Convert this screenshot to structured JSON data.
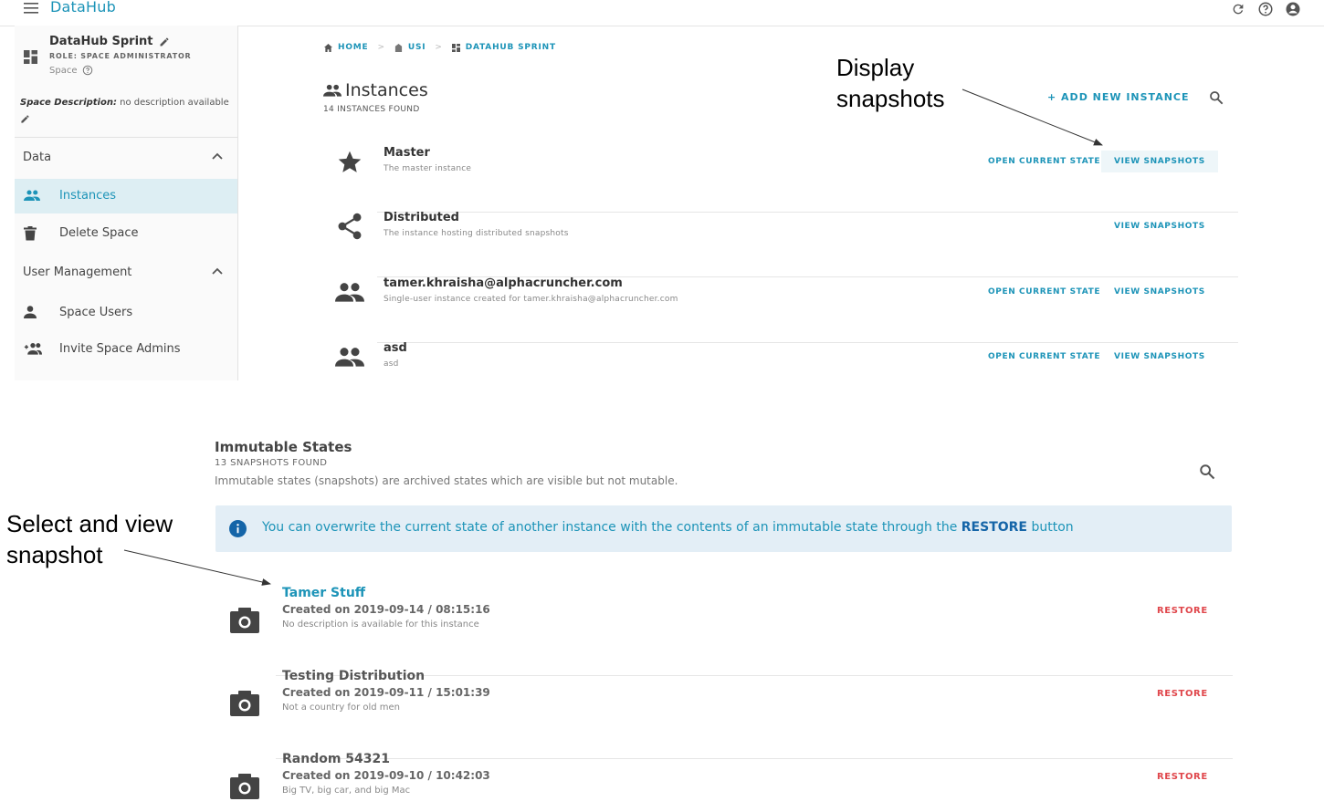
{
  "app": {
    "title": "DataHub"
  },
  "sidebar": {
    "space_name": "DataHub Sprint",
    "role": "ROLE: SPACE ADMINISTRATOR",
    "type_label": "Space",
    "description_label": "Space Description:",
    "description_value": "no description available",
    "sections": [
      {
        "label": "Data",
        "items": [
          {
            "label": "Instances",
            "icon": "people-icon",
            "active": true
          },
          {
            "label": "Delete Space",
            "icon": "trash-icon"
          }
        ]
      },
      {
        "label": "User Management",
        "items": [
          {
            "label": "Space Users",
            "icon": "person-icon"
          },
          {
            "label": "Invite Space Admins",
            "icon": "group-add-icon"
          }
        ]
      }
    ]
  },
  "breadcrumb": {
    "home": "HOME",
    "usi": "USI",
    "sprint": "DATAHUB SPRINT"
  },
  "instances": {
    "title": "Instances",
    "count": "14 INSTANCES FOUND",
    "add_label": "+ ADD NEW INSTANCE",
    "open_label": "OPEN CURRENT STATE",
    "view_label": "VIEW SNAPSHOTS",
    "rows": [
      {
        "name": "Master",
        "desc": "The master instance",
        "icon": "star-icon"
      },
      {
        "name": "Distributed",
        "desc": "The instance hosting distributed snapshots",
        "icon": "share-icon"
      },
      {
        "name": "tamer.khraisha@alphacruncher.com",
        "desc": "Single-user instance created for tamer.khraisha@alphacruncher.com",
        "icon": "people-icon"
      },
      {
        "name": "asd",
        "desc": "asd",
        "icon": "people-icon"
      }
    ]
  },
  "annotations": {
    "display_line1": "Display",
    "display_line2": "snapshots",
    "select_line1": "Select and view",
    "select_line2": "snapshot"
  },
  "immutable": {
    "title": "Immutable States",
    "count": "13 SNAPSHOTS FOUND",
    "description": "Immutable states (snapshots) are archived states which are visible but not mutable.",
    "info_before": "You can overwrite the current state of another instance with the contents of an immutable state through the",
    "info_bold": "RESTORE",
    "info_after": "button",
    "restore_label": "RESTORE",
    "created_label": "Created on",
    "snapshots": [
      {
        "name": "Tamer Stuff",
        "created": "2019-09-14 / 08:15:16",
        "desc": "No description is available for this instance"
      },
      {
        "name": "Testing Distribution",
        "created": "2019-09-11 / 15:01:39",
        "desc": "Not a country for old men"
      },
      {
        "name": "Random 54321",
        "created": "2019-09-10 / 10:42:03",
        "desc": "Big TV, big car, and big Mac"
      }
    ]
  }
}
